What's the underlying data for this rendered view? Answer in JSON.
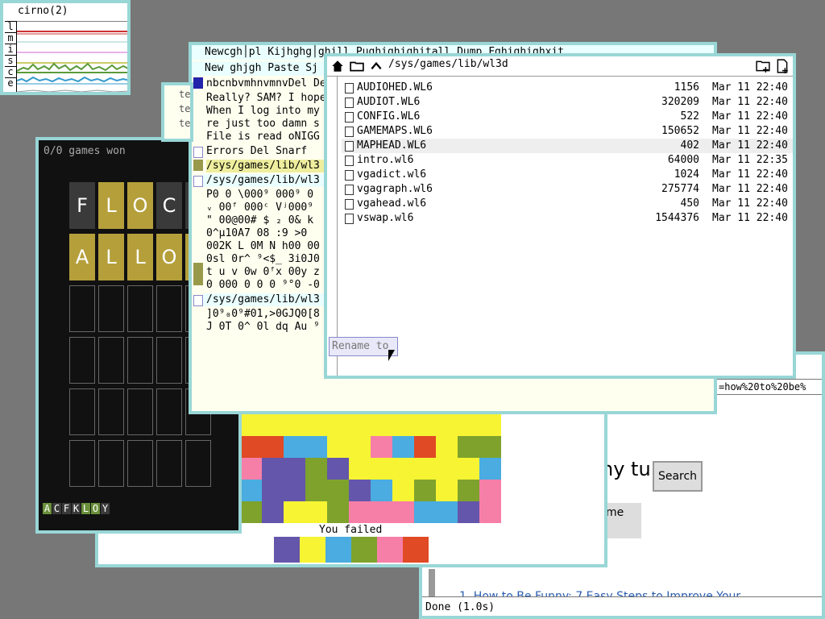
{
  "stats": {
    "title": "cirno(2)",
    "letters": [
      "l",
      "m",
      "i",
      "s",
      "c",
      "e"
    ]
  },
  "browser": {
    "url": "=how%20to%20be%",
    "big_text": "ny tu",
    "search_label": "Search",
    "me_label": "me",
    "link_text": "1.  How to Be Funny: 7 Easy Steps to Improve Your",
    "status": "Done (1.0s)"
  },
  "colorgame": {
    "result": "You failed",
    "swatches": [
      "#6456aa",
      "#f7f433",
      "#4aace0",
      "#7ea22c",
      "#f67fa8",
      "#e04a25"
    ],
    "grid_colors": [
      [
        "#f7f433",
        "#f7f433",
        "#f7f433",
        "#f7f433",
        "#f7f433",
        "#f7f433",
        "#f7f433",
        "#f7f433",
        "#f7f433",
        "#f7f433",
        "#f7f433",
        "#f7f433"
      ],
      [
        "#e04a25",
        "#e04a25",
        "#4aace0",
        "#4aace0",
        "#f7f433",
        "#f7f433",
        "#f67fa8",
        "#4aace0",
        "#e04a25",
        "#f7f433",
        "#7ea22c",
        "#7ea22c"
      ],
      [
        "#f67fa8",
        "#6456aa",
        "#6456aa",
        "#7ea22c",
        "#6456aa",
        "#f7f433",
        "#f7f433",
        "#f7f433",
        "#f7f433",
        "#f7f433",
        "#f7f433",
        "#4aace0"
      ],
      [
        "#4aace0",
        "#6456aa",
        "#6456aa",
        "#7ea22c",
        "#7ea22c",
        "#6456aa",
        "#4aace0",
        "#f7f433",
        "#7ea22c",
        "#f7f433",
        "#7ea22c",
        "#f67fa8"
      ],
      [
        "#7ea22c",
        "#6456aa",
        "#f7f433",
        "#f7f433",
        "#7ea22c",
        "#f67fa8",
        "#f67fa8",
        "#f67fa8",
        "#4aace0",
        "#4aace0",
        "#6456aa",
        "#f67fa8"
      ]
    ]
  },
  "wordle": {
    "score": "0/0 games won",
    "row1": [
      {
        "l": "F",
        "c": "#3a3a3a"
      },
      {
        "l": "L",
        "c": "#b59f3b"
      },
      {
        "l": "O",
        "c": "#b59f3b"
      },
      {
        "l": "C",
        "c": "#3a3a3a"
      },
      {
        "l": "",
        "c": "#3a3a3a"
      }
    ],
    "row2": [
      {
        "l": "A",
        "c": "#b59f3b"
      },
      {
        "l": "L",
        "c": "#b59f3b"
      },
      {
        "l": "L",
        "c": "#b59f3b"
      },
      {
        "l": "O",
        "c": "#b59f3b"
      },
      {
        "l": "",
        "c": "#b59f3b"
      }
    ],
    "keys": [
      {
        "k": "A",
        "c": "#6a8f3a"
      },
      {
        "k": "C",
        "c": "#3a3a3a"
      },
      {
        "k": "F",
        "c": "#3a3a3a"
      },
      {
        "k": "K",
        "c": "#3a3a3a"
      },
      {
        "k": "L",
        "c": "#6a8f3a"
      },
      {
        "k": "O",
        "c": "#6a8f3a"
      },
      {
        "k": "Y",
        "c": "#3a3a3a"
      }
    ]
  },
  "editor": {
    "tag1": "Newcgh│pl Kijhghg│ghill Pughighighitall Dump Fghighighxit",
    "tag2": "New ghjgh Paste Sj",
    "lines1": [
      "nbcnbvmhnvmnvDel De",
      "Really? SAM? I hope",
      "When I log into my",
      "re just too damn s",
      "File is read oNIGG"
    ],
    "errors": "Errors Del Snarf",
    "path1": "/sys/games/lib/wl3",
    "path2": "/sys/games/lib/wl3",
    "lines2": [
      "P0 0  \\000⁹ 000⁹ 0",
      "  ᵥ 00ᶠ 000ᶜ Vʲ000⁹",
      "  \" 00@00# $ ₂ 0& k",
      "  0^µ10A7 08 :9 >0",
      "002K L 0M N h00 00",
      "0sl 0r^ ⁹<$_ 3i0J0",
      "t u v 0w 0ᶠx 00y z",
      "0 000 0 0 0 ⁹°0 -0"
    ],
    "path3": "/sys/games/lib/wl3",
    "lines3": [
      "]0⁹₀0⁹#01,>0GJQ0[8",
      "J 0T 0^ 0l dq Au ⁹"
    ],
    "side_tag": "te"
  },
  "files": {
    "path": "/sys/games/lib/wl3d",
    "rename_placeholder": "Rename to",
    "rows": [
      {
        "name": "AUDIOHED.WL6",
        "size": "1156",
        "date": "Mar 11 22:40"
      },
      {
        "name": "AUDIOT.WL6",
        "size": "320209",
        "date": "Mar 11 22:40"
      },
      {
        "name": "CONFIG.WL6",
        "size": "522",
        "date": "Mar 11 22:40"
      },
      {
        "name": "GAMEMAPS.WL6",
        "size": "150652",
        "date": "Mar 11 22:40"
      },
      {
        "name": "MAPHEAD.WL6",
        "size": "402",
        "date": "Mar 11 22:40"
      },
      {
        "name": "intro.wl6",
        "size": "64000",
        "date": "Mar 11 22:35"
      },
      {
        "name": "vgadict.wl6",
        "size": "1024",
        "date": "Mar 11 22:40"
      },
      {
        "name": "vgagraph.wl6",
        "size": "275774",
        "date": "Mar 11 22:40"
      },
      {
        "name": "vgahead.wl6",
        "size": "450",
        "date": "Mar 11 22:40"
      },
      {
        "name": "vswap.wl6",
        "size": "1544376",
        "date": "Mar 11 22:40"
      }
    ]
  }
}
